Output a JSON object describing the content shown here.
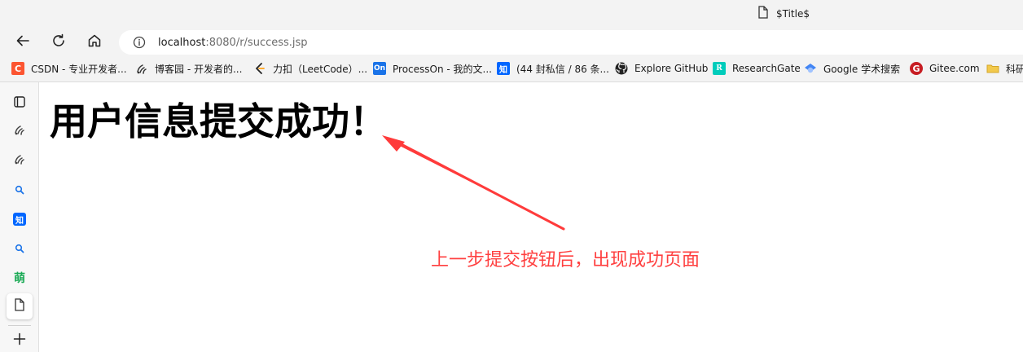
{
  "tab": {
    "title": "$Title$",
    "icon": "page-icon"
  },
  "navigation": {
    "back_icon": "back-arrow-icon",
    "reload_icon": "reload-icon",
    "home_icon": "home-icon",
    "info_icon": "info-icon",
    "url_host": "localhost",
    "url_path": ":8080/r/success.jsp"
  },
  "bookmarks": [
    {
      "label": "CSDN - 专业开发者...",
      "icon": "csdn-icon",
      "icon_text": "C"
    },
    {
      "label": "博客园 - 开发者的...",
      "icon": "cnblogs-icon",
      "icon_text": ""
    },
    {
      "label": "力扣（LeetCode）...",
      "icon": "leetcode-icon",
      "icon_text": ""
    },
    {
      "label": "ProcessOn - 我的文...",
      "icon": "processon-icon",
      "icon_text": "On"
    },
    {
      "label": "(44 封私信 / 86 条...",
      "icon": "zhihu-icon",
      "icon_text": "知"
    },
    {
      "label": "Explore GitHub",
      "icon": "github-icon",
      "icon_text": ""
    },
    {
      "label": "ResearchGate",
      "icon": "researchgate-icon",
      "icon_text": "R"
    },
    {
      "label": "Google 学术搜索",
      "icon": "google-scholar-icon",
      "icon_text": ""
    },
    {
      "label": "Gitee.com",
      "icon": "gitee-icon",
      "icon_text": "G"
    },
    {
      "label": "科研",
      "icon": "folder-icon",
      "icon_text": ""
    }
  ],
  "sidebar": {
    "items": [
      {
        "icon": "tabs-icon"
      },
      {
        "icon": "cnblogs-icon"
      },
      {
        "icon": "cnblogs-icon"
      },
      {
        "icon": "search-icon"
      },
      {
        "icon": "zhihu-icon",
        "text": "知"
      },
      {
        "icon": "search-icon"
      },
      {
        "icon": "mengzi-icon",
        "text": "萌"
      },
      {
        "icon": "page-icon"
      },
      {
        "icon": "add-icon"
      }
    ]
  },
  "page": {
    "heading": "用户信息提交成功！",
    "annotation": "上一步提交按钮后，出现成功页面"
  },
  "colors": {
    "annotation": "#ff4040",
    "chrome_bg": "#f3f3f3",
    "heading": "#000000"
  }
}
